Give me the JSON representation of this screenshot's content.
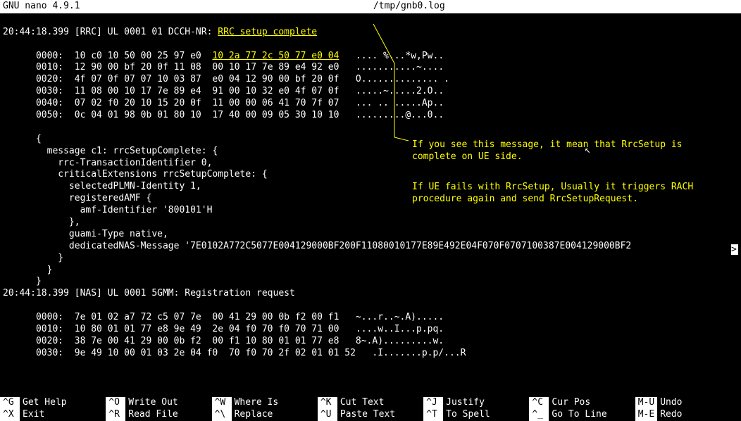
{
  "titlebar": {
    "app": "GNU nano",
    "version": "4.9.1",
    "file": "/tmp/gnb0.log"
  },
  "log": {
    "line1_prefix": "20:44:18.399 [RRC] UL 0001 01 DCCH-NR: ",
    "line1_msg": "RRC setup complete",
    "hex_rows": [
      {
        "offset": "0000:",
        "a": "10 c0 10 50 00 25 97 e0",
        "b": "10 2a 77 2c 50 77 e0 04",
        "ascii": ".... %...*w,Pw.."
      },
      {
        "offset": "0010:",
        "a": "12 90 00 bf 20 0f 11 08",
        "b": "00 10 17 7e 89 e4 92 e0",
        "ascii": "...........~...."
      },
      {
        "offset": "0020:",
        "a": "4f 07 0f 07 07 10 03 87",
        "b": "e0 04 12 90 00 bf 20 0f",
        "ascii": "O.............. ."
      },
      {
        "offset": "0030:",
        "a": "11 08 00 10 17 7e 89 e4",
        "b": "91 00 10 32 e0 4f 07 0f",
        "ascii": ".....~.....2.O.."
      },
      {
        "offset": "0040:",
        "a": "07 02 f0 20 10 15 20 0f",
        "b": "11 00 00 06 41 70 7f 07",
        "ascii": "... .. .....Ap.."
      },
      {
        "offset": "0050:",
        "a": "0c 04 01 98 0b 01 80 10",
        "b": "17 40 00 09 05 30 10 10",
        "ascii": ".........@...0.."
      }
    ],
    "json_lines": [
      "      {",
      "        message c1: rrcSetupComplete: {",
      "          rrc-TransactionIdentifier 0,",
      "          criticalExtensions rrcSetupComplete: {",
      "            selectedPLMN-Identity 1,",
      "            registeredAMF {",
      "              amf-Identifier '800101'H",
      "            },",
      "            guami-Type native,",
      "            dedicatedNAS-Message '7E0102A772C5077E004129000BF200F11080010177E89E492E04F070F0707100387E004129000BF2",
      "          }",
      "        }",
      "      }",
      "",
      "20:44:18.399 [NAS] UL 0001 5GMM: Registration request"
    ],
    "hex_rows2": [
      {
        "offset": "0000:",
        "a": "7e 01 02 a7 72 c5 07 7e",
        "b": "00 41 29 00 0b f2 00 f1",
        "ascii": "~...r..~.A)....."
      },
      {
        "offset": "0010:",
        "a": "10 80 01 01 77 e8 9e 49",
        "b": "2e 04 f0 70 f0 70 71 00",
        "ascii": "....w..I...p.pq."
      },
      {
        "offset": "0020:",
        "a": "38 7e 00 41 29 00 0b f2",
        "b": "00 f1 10 80 01 01 77 e8",
        "ascii": "8~.A).........w."
      },
      {
        "offset": "0030:",
        "a": "9e 49 10 00 01 03 2e 04 f0",
        "b": "70 f0 70 2f 02 01 01 52",
        "ascii": ".I.......p.p/...R"
      }
    ]
  },
  "annotation": {
    "p1": "If you see this message, it mean that RrcSetup is complete on UE side.",
    "p2": "If UE fails with RrcSetup, Usually it triggers RACH procedure again and send RrcSetupRequest."
  },
  "footer": [
    {
      "key": "^G",
      "label": "Get Help"
    },
    {
      "key": "^O",
      "label": "Write Out"
    },
    {
      "key": "^W",
      "label": "Where Is"
    },
    {
      "key": "^K",
      "label": "Cut Text"
    },
    {
      "key": "^J",
      "label": "Justify"
    },
    {
      "key": "^C",
      "label": "Cur Pos"
    },
    {
      "key": "M-U",
      "label": "Undo"
    },
    {
      "key": "^X",
      "label": "Exit"
    },
    {
      "key": "^R",
      "label": "Read File"
    },
    {
      "key": "^\\",
      "label": "Replace"
    },
    {
      "key": "^U",
      "label": "Paste Text"
    },
    {
      "key": "^T",
      "label": "To Spell"
    },
    {
      "key": "^_",
      "label": "Go To Line"
    },
    {
      "key": "M-E",
      "label": "Redo"
    }
  ]
}
